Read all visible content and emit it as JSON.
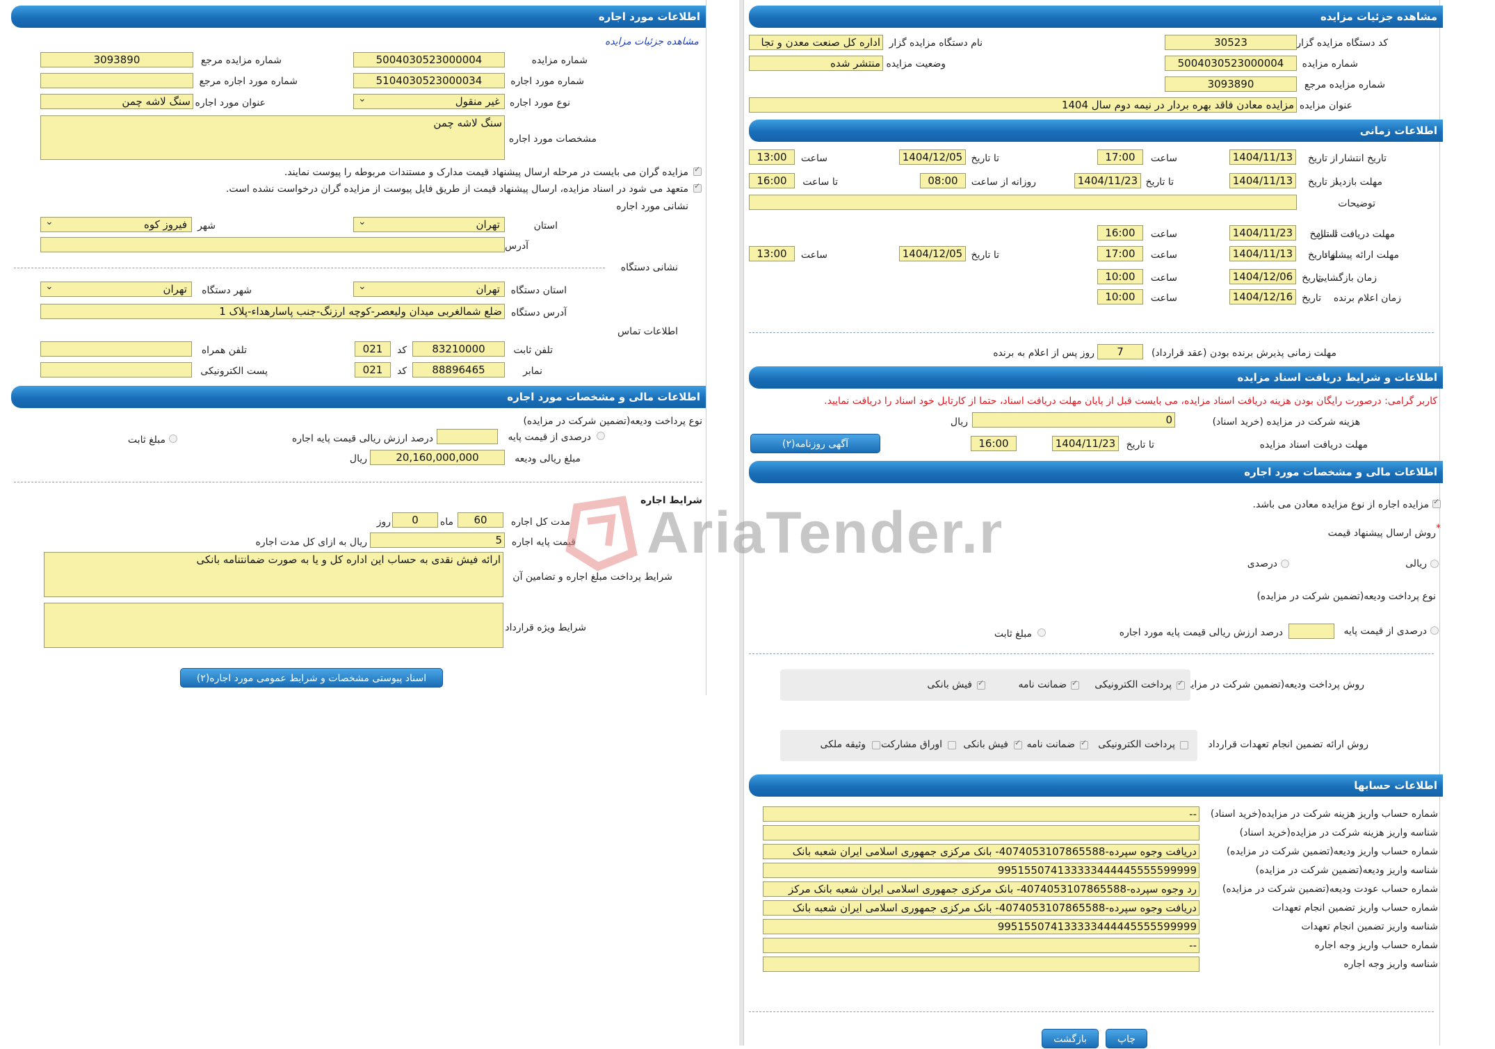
{
  "left": {
    "lease_header": "اطلاعات مورد اجاره",
    "view_details_link": "مشاهده جزئیات مزایده",
    "auction_number_label": "شماره مزایده",
    "auction_number": "5004030523000004",
    "ref_auction_number_label": "شماره مزایده مرجع",
    "ref_auction_number": "3093890",
    "lease_item_number_label": "شماره مورد اجاره",
    "lease_item_number": "5104030523000034",
    "ref_lease_item_number_label": "شماره مورد اجاره مرجع",
    "ref_lease_item_number": "",
    "lease_type_label": "نوع مورد اجاره",
    "lease_type": "غیر منقول",
    "lease_title_label": "عنوان مورد اجاره",
    "lease_title": "سنگ لاشه چمن",
    "lease_spec_label": "مشخصات مورد اجاره",
    "lease_spec": "سنگ لاشه چمن",
    "check1_text": "مزایده گران می بایست در مرحله ارسال پیشنهاد قیمت مدارک و مستندات مربوطه را پیوست نمایند.",
    "check2_text": "متعهد می شود در اسناد مزایده، ارسال پیشنهاد قیمت از طریق فایل پیوست از مزایده گران درخواست نشده است.",
    "lease_address_section": "نشانی مورد اجاره",
    "province_label": "استان",
    "province": "تهران",
    "city_label": "شهر",
    "city": "فیروز کوه",
    "address_label": "آدرس",
    "address": "",
    "org_address_section": "نشانی دستگاه",
    "org_province_label": "استان دستگاه",
    "org_province": "تهران",
    "org_city_label": "شهر دستگاه",
    "org_city": "تهران",
    "org_address_label": "آدرس دستگاه",
    "org_address": "ضلع شمالغربی میدان ولیعصر-کوچه ارزنگ-جنب پاسارهداء-پلاک 1",
    "contact_section": "اطلاعات تماس",
    "phone_label": "تلفن ثابت",
    "phone": "83210000",
    "code_label": "کد",
    "phone_code": "021",
    "mobile_label": "تلفن همراه",
    "mobile": "",
    "fax_label": "نمابر",
    "fax": "88896465",
    "fax_code": "021",
    "email_label": "پست الکترونیکی",
    "email": "",
    "financial_header": "اطلاعات مالی و مشخصات مورد اجاره",
    "deposit_type_label": "نوع پرداخت ودیعه(تضمین شرکت در مزایده)",
    "deposit_percent_label": "درصدی از قیمت پایه",
    "deposit_percent_value_label": "درصد ارزش ریالی قیمت پایه اجاره",
    "deposit_percent_value": "",
    "deposit_fixed_label": "مبلغ ثابت",
    "deposit_amount_label": "مبلغ ریالی ودیعه",
    "deposit_amount": "20,160,000,000",
    "rial": "ریال",
    "lease_terms_header": "شرایط اجاره",
    "duration_label": "مدت کل اجاره",
    "duration_months": "60",
    "month_label": "ماه",
    "duration_days": "0",
    "day_label": "روز",
    "base_price_label": "قیمت پایه اجاره",
    "base_price": "5",
    "base_price_suffix": "ریال به ازای کل مدت اجاره",
    "payment_terms_label": "شرایط پرداخت مبلغ اجاره و تضامین آن",
    "payment_terms": "ارائه فیش نقدی به حساب این اداره کل و یا به صورت ضمانتنامه بانکی",
    "special_terms_label": "شرایط ویژه قرارداد",
    "special_terms": "",
    "attachments_button": "اسناد پیوستی مشخصات و شرایط عمومی مورد اجاره(۲)"
  },
  "right": {
    "details_header": "مشاهده جزئیات مزایده",
    "org_code_label": "کد دستگاه مزایده گزار",
    "org_code": "30523",
    "org_name_label": "نام دستگاه مزایده گزار",
    "org_name": "اداره کل صنعت  معدن و تجا",
    "auction_number_label": "شماره مزایده",
    "auction_number": "5004030523000004",
    "status_label": "وضعیت مزایده",
    "status": "منتشر شده",
    "ref_number_label": "شماره مزایده مرجع",
    "ref_number": "3093890",
    "title_label": "عنوان مزایده",
    "title": "مزایده معادن فاقد بهره بردار در نیمه دوم سال 1404",
    "time_header": "اطلاعات زمانی",
    "publish_label": "تاریخ انتشار",
    "from_date_label": "از تاریخ",
    "to_date_label": "تا تاریخ",
    "time_label": "ساعت",
    "publish_from": "1404/11/13",
    "publish_from_time": "17:00",
    "publish_to": "1404/12/05",
    "publish_to_time": "13:00",
    "visit_label": "مهلت بازدید",
    "visit_from": "1404/11/13",
    "visit_to": "1404/11/23",
    "daily_from_label": "روزانه از ساعت",
    "daily_from": "08:00",
    "until_time_label": "تا ساعت",
    "daily_to": "16:00",
    "notes_label": "توضیحات",
    "notes": "",
    "doc_deadline_label": "مهلت دریافت اسناد",
    "doc_deadline": "1404/11/23",
    "doc_deadline_time": "16:00",
    "offer_label": "مهلت ارائه پیشنهاد",
    "offer_from": "1404/11/13",
    "offer_from_time": "17:00",
    "offer_to": "1404/12/05",
    "offer_to_time": "13:00",
    "opening_label": "زمان بازگشایی",
    "date_label": "تاریخ",
    "opening_date": "1404/12/06",
    "opening_time": "10:00",
    "winner_label": "زمان اعلام برنده",
    "winner_date": "1404/12/16",
    "winner_time": "10:00",
    "acceptance_label": "مهلت زمانی پذیرش برنده بودن (عقد قرارداد)",
    "acceptance_days": "7",
    "acceptance_suffix": "روز پس از اعلام به برنده",
    "docs_header": "اطلاعات و شرایط دریافت اسناد مزایده",
    "docs_notice": "کاربر گرامی: درصورت رایگان بودن هزینه دریافت اسناد مزایده، می بایست قبل از پایان مهلت دریافت اسناد، حتما از کارتابل خود اسناد را دریافت نمایید.",
    "doc_fee_label": "هزینه شرکت در مزایده (خرید اسناد)",
    "doc_fee": "0",
    "rial": "ریال",
    "doc_receive_label": "مهلت دریافت اسناد مزایده",
    "doc_receive_date": "1404/11/23",
    "doc_receive_time": "16:00",
    "newspaper_button": "آگهی روزنامه(۲)",
    "financial_header": "اطلاعات مالی و مشخصات مورد اجاره",
    "mine_check_label": "مزایده اجاره از نوع مزایده معادن می باشد.",
    "offer_method_label": "روش ارسال پیشنهاد قیمت",
    "rial_option": "ریالی",
    "percent_option": "درصدی",
    "deposit_type_label": "نوع پرداخت ودیعه(تضمین شرکت در مزایده)",
    "deposit_percent_label": "درصدی از قیمت پایه",
    "deposit_percent_value_label": "درصد ارزش ریالی قیمت پایه مورد اجاره",
    "deposit_percent_value": "",
    "deposit_fixed_label": "مبلغ ثابت",
    "deposit_method_label": "روش پرداخت ودیعه(تضمین شرکت در مزایده)",
    "electronic_payment": "پرداخت الکترونیکی",
    "guarantee": "ضمانت نامه",
    "bank_receipt": "فیش بانکی",
    "commitment_method_label": "روش ارائه تضمین انجام تعهدات قرارداد",
    "participation_bonds": "اوراق مشارکت",
    "property_collateral": "وثیقه ملکی",
    "accounts_header": "اطلاعات حسابها",
    "accounts": [
      {
        "label": "شماره حساب واریز هزینه شرکت در مزایده(خرید اسناد)",
        "value": "--"
      },
      {
        "label": "شناسه واریز هزینه شرکت در مزایده(خرید اسناد)",
        "value": ""
      },
      {
        "label": "شماره حساب واریز ودیعه(تضمین شرکت در مزایده)",
        "value": "دریافت وجوه سپرده-4074053107865588- بانک مرکزی جمهوری اسلامی ایران شعبه بانک"
      },
      {
        "label": "شناسه واریز ودیعه(تضمین شرکت در مزایده)",
        "value": "995155074133333444445555599999"
      },
      {
        "label": "شماره حساب عودت ودیعه(تضمین شرکت در مزایده)",
        "value": "رد وجوه سپرده-4074053107865588- بانک مرکزی جمهوری اسلامی ایران شعبه بانک مرکز"
      },
      {
        "label": "شماره حساب واریز تضمین انجام تعهدات",
        "value": "دریافت وجوه سپرده-4074053107865588- بانک مرکزی جمهوری اسلامی ایران شعبه بانک"
      },
      {
        "label": "شناسه واریز تضمین انجام تعهدات",
        "value": "995155074133333444445555599999"
      },
      {
        "label": "شماره حساب واریز وجه اجاره",
        "value": "--"
      },
      {
        "label": "شناسه واریز وجه اجاره",
        "value": ""
      }
    ],
    "print_button": "چاپ",
    "back_button": "بازگشت"
  },
  "watermark": "AriaTender.neT",
  "colors": {
    "header": "#1a6fb8",
    "field": "#f7f2a8",
    "accent": "#e0151e"
  }
}
